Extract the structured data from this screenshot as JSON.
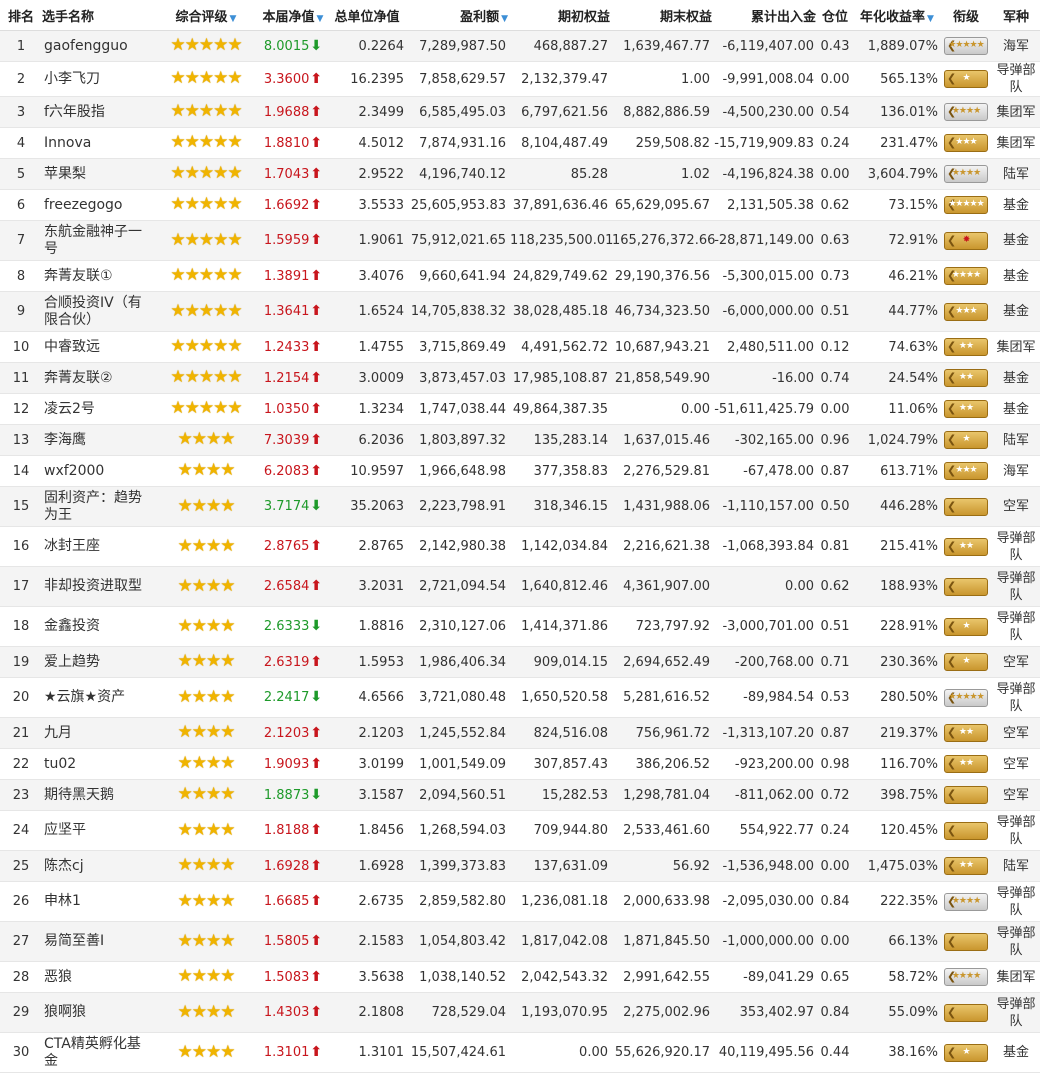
{
  "headers": {
    "rank": "排名",
    "name": "选手名称",
    "rating": "综合评级",
    "nav": "本届净值",
    "total_nav": "总单位净值",
    "profit": "盈利额",
    "begin_equity": "期初权益",
    "end_equity": "期末权益",
    "net_flow": "累计出入金",
    "position": "仓位",
    "annual": "年化收益率",
    "title": "衔级",
    "branch": "军种"
  },
  "rows": [
    {
      "rank": "1",
      "name": "gaofengguo",
      "stars": "★★★★★",
      "nav": "8.0015",
      "dir": "down",
      "total": "0.2264",
      "profit": "7,289,987.50",
      "begin": "468,887.27",
      "end": "1,639,467.77",
      "flow": "-6,119,407.00",
      "pos": "0.43",
      "annual": "1,889.07%",
      "badge": "★★★★★",
      "badge_style": "silver",
      "branch": "海军"
    },
    {
      "rank": "2",
      "name": "小李飞刀",
      "stars": "★★★★★",
      "nav": "3.3600",
      "dir": "up",
      "total": "16.2395",
      "profit": "7,858,629.57",
      "begin": "2,132,379.47",
      "end": "1.00",
      "flow": "-9,991,008.04",
      "pos": "0.00",
      "annual": "565.13%",
      "badge": "★",
      "badge_style": "gold",
      "branch": "导弹部队"
    },
    {
      "rank": "3",
      "name": "f六年股指",
      "stars": "★★★★★",
      "nav": "1.9688",
      "dir": "up",
      "total": "2.3499",
      "profit": "6,585,495.03",
      "begin": "6,797,621.56",
      "end": "8,882,886.59",
      "flow": "-4,500,230.00",
      "pos": "0.54",
      "annual": "136.01%",
      "badge": "★★★★",
      "badge_style": "silver",
      "branch": "集团军"
    },
    {
      "rank": "4",
      "name": "Innova",
      "stars": "★★★★★",
      "nav": "1.8810",
      "dir": "up",
      "total": "4.5012",
      "profit": "7,874,931.16",
      "begin": "8,104,487.49",
      "end": "259,508.82",
      "flow": "-15,719,909.83",
      "pos": "0.24",
      "annual": "231.47%",
      "badge": "★★★",
      "badge_style": "gold",
      "branch": "集团军"
    },
    {
      "rank": "5",
      "name": "苹果梨",
      "stars": "★★★★★",
      "nav": "1.7043",
      "dir": "up",
      "total": "2.9522",
      "profit": "4,196,740.12",
      "begin": "85.28",
      "end": "1.02",
      "flow": "-4,196,824.38",
      "pos": "0.00",
      "annual": "3,604.79%",
      "badge": "★★★★",
      "badge_style": "silver",
      "branch": "陆军"
    },
    {
      "rank": "6",
      "name": "freezegogo",
      "stars": "★★★★★",
      "nav": "1.6692",
      "dir": "up",
      "total": "3.5533",
      "profit": "25,605,953.83",
      "begin": "37,891,636.46",
      "end": "65,629,095.67",
      "flow": "2,131,505.38",
      "pos": "0.62",
      "annual": "73.15%",
      "badge": "★★★★★",
      "badge_style": "gold",
      "branch": "基金"
    },
    {
      "rank": "7",
      "name": "东航金融神子一号",
      "stars": "★★★★★",
      "nav": "1.5959",
      "dir": "up",
      "total": "1.9061",
      "profit": "75,912,021.65",
      "begin": "118,235,500.01",
      "end": "165,276,372.66",
      "flow": "-28,871,149.00",
      "pos": "0.63",
      "annual": "72.91%",
      "badge": "✸",
      "badge_style": "red",
      "branch": "基金",
      "tall": true
    },
    {
      "rank": "8",
      "name": "奔菁友联①",
      "stars": "★★★★★",
      "nav": "1.3891",
      "dir": "up",
      "total": "3.4076",
      "profit": "9,660,641.94",
      "begin": "24,829,749.62",
      "end": "29,190,376.56",
      "flow": "-5,300,015.00",
      "pos": "0.73",
      "annual": "46.21%",
      "badge": "★★★★",
      "badge_style": "gold",
      "branch": "基金"
    },
    {
      "rank": "9",
      "name": "合顺投资IV（有限合伙）",
      "stars": "★★★★★",
      "nav": "1.3641",
      "dir": "up",
      "total": "1.6524",
      "profit": "14,705,838.32",
      "begin": "38,028,485.18",
      "end": "46,734,323.50",
      "flow": "-6,000,000.00",
      "pos": "0.51",
      "annual": "44.77%",
      "badge": "★★★",
      "badge_style": "gold",
      "branch": "基金",
      "tall": true
    },
    {
      "rank": "10",
      "name": "中睿致远",
      "stars": "★★★★★",
      "nav": "1.2433",
      "dir": "up",
      "total": "1.4755",
      "profit": "3,715,869.49",
      "begin": "4,491,562.72",
      "end": "10,687,943.21",
      "flow": "2,480,511.00",
      "pos": "0.12",
      "annual": "74.63%",
      "badge": "★★",
      "badge_style": "gold",
      "branch": "集团军"
    },
    {
      "rank": "11",
      "name": "奔菁友联②",
      "stars": "★★★★★",
      "nav": "1.2154",
      "dir": "up",
      "total": "3.0009",
      "profit": "3,873,457.03",
      "begin": "17,985,108.87",
      "end": "21,858,549.90",
      "flow": "-16.00",
      "pos": "0.74",
      "annual": "24.54%",
      "badge": "★★",
      "badge_style": "gold",
      "branch": "基金"
    },
    {
      "rank": "12",
      "name": "凌云2号",
      "stars": "★★★★★",
      "nav": "1.0350",
      "dir": "up",
      "total": "1.3234",
      "profit": "1,747,038.44",
      "begin": "49,864,387.35",
      "end": "0.00",
      "flow": "-51,611,425.79",
      "pos": "0.00",
      "annual": "11.06%",
      "badge": "★★",
      "badge_style": "gold",
      "branch": "基金"
    },
    {
      "rank": "13",
      "name": "李海鹰",
      "stars": "★★★★",
      "nav": "7.3039",
      "dir": "up",
      "total": "6.2036",
      "profit": "1,803,897.32",
      "begin": "135,283.14",
      "end": "1,637,015.46",
      "flow": "-302,165.00",
      "pos": "0.96",
      "annual": "1,024.79%",
      "badge": "★",
      "badge_style": "gold",
      "branch": "陆军"
    },
    {
      "rank": "14",
      "name": "wxf2000",
      "stars": "★★★★",
      "nav": "6.2083",
      "dir": "up",
      "total": "10.9597",
      "profit": "1,966,648.98",
      "begin": "377,358.83",
      "end": "2,276,529.81",
      "flow": "-67,478.00",
      "pos": "0.87",
      "annual": "613.71%",
      "badge": "★★★",
      "badge_style": "gold",
      "branch": "海军"
    },
    {
      "rank": "15",
      "name": "固利资产：趋势为王",
      "stars": "★★★★",
      "nav": "3.7174",
      "dir": "down",
      "total": "35.2063",
      "profit": "2,223,798.91",
      "begin": "318,346.15",
      "end": "1,431,988.06",
      "flow": "-1,110,157.00",
      "pos": "0.50",
      "annual": "446.28%",
      "badge": "",
      "badge_style": "gold",
      "branch": "空军",
      "tall": true
    },
    {
      "rank": "16",
      "name": "冰封王座",
      "stars": "★★★★",
      "nav": "2.8765",
      "dir": "up",
      "total": "2.8765",
      "profit": "2,142,980.38",
      "begin": "1,142,034.84",
      "end": "2,216,621.38",
      "flow": "-1,068,393.84",
      "pos": "0.81",
      "annual": "215.41%",
      "badge": "★★",
      "badge_style": "gold",
      "branch": "导弹部队",
      "tall": true
    },
    {
      "rank": "17",
      "name": "非却投资进取型",
      "stars": "★★★★",
      "nav": "2.6584",
      "dir": "up",
      "total": "3.2031",
      "profit": "2,721,094.54",
      "begin": "1,640,812.46",
      "end": "4,361,907.00",
      "flow": "0.00",
      "pos": "0.62",
      "annual": "188.93%",
      "badge": "",
      "badge_style": "gold",
      "branch": "导弹部队",
      "tall": true
    },
    {
      "rank": "18",
      "name": "金鑫投资",
      "stars": "★★★★",
      "nav": "2.6333",
      "dir": "down",
      "total": "1.8816",
      "profit": "2,310,127.06",
      "begin": "1,414,371.86",
      "end": "723,797.92",
      "flow": "-3,000,701.00",
      "pos": "0.51",
      "annual": "228.91%",
      "badge": "★",
      "badge_style": "gold",
      "branch": "导弹部队",
      "tall": true
    },
    {
      "rank": "19",
      "name": "爱上趋势",
      "stars": "★★★★",
      "nav": "2.6319",
      "dir": "up",
      "total": "1.5953",
      "profit": "1,986,406.34",
      "begin": "909,014.15",
      "end": "2,694,652.49",
      "flow": "-200,768.00",
      "pos": "0.71",
      "annual": "230.36%",
      "badge": "★",
      "badge_style": "gold",
      "branch": "空军"
    },
    {
      "rank": "20",
      "name": "★云旗★资产",
      "stars": "★★★★",
      "nav": "2.2417",
      "dir": "down",
      "total": "4.6566",
      "profit": "3,721,080.48",
      "begin": "1,650,520.58",
      "end": "5,281,616.52",
      "flow": "-89,984.54",
      "pos": "0.53",
      "annual": "280.50%",
      "badge": "★★★★★",
      "badge_style": "silver",
      "branch": "导弹部队",
      "tall": true
    },
    {
      "rank": "21",
      "name": "九月",
      "stars": "★★★★",
      "nav": "2.1203",
      "dir": "up",
      "total": "2.1203",
      "profit": "1,245,552.84",
      "begin": "824,516.08",
      "end": "756,961.72",
      "flow": "-1,313,107.20",
      "pos": "0.87",
      "annual": "219.37%",
      "badge": "★★",
      "badge_style": "gold",
      "branch": "空军"
    },
    {
      "rank": "22",
      "name": "tu02",
      "stars": "★★★★",
      "nav": "1.9093",
      "dir": "up",
      "total": "3.0199",
      "profit": "1,001,549.09",
      "begin": "307,857.43",
      "end": "386,206.52",
      "flow": "-923,200.00",
      "pos": "0.98",
      "annual": "116.70%",
      "badge": "★★",
      "badge_style": "gold",
      "branch": "空军"
    },
    {
      "rank": "23",
      "name": "期待黑天鹅",
      "stars": "★★★★",
      "nav": "1.8873",
      "dir": "down",
      "total": "3.1587",
      "profit": "2,094,560.51",
      "begin": "15,282.53",
      "end": "1,298,781.04",
      "flow": "-811,062.00",
      "pos": "0.72",
      "annual": "398.75%",
      "badge": "",
      "badge_style": "gold",
      "branch": "空军"
    },
    {
      "rank": "24",
      "name": "应坚平",
      "stars": "★★★★",
      "nav": "1.8188",
      "dir": "up",
      "total": "1.8456",
      "profit": "1,268,594.03",
      "begin": "709,944.80",
      "end": "2,533,461.60",
      "flow": "554,922.77",
      "pos": "0.24",
      "annual": "120.45%",
      "badge": "",
      "badge_style": "gold",
      "branch": "导弹部队",
      "tall": true
    },
    {
      "rank": "25",
      "name": "陈杰cj",
      "stars": "★★★★",
      "nav": "1.6928",
      "dir": "up",
      "total": "1.6928",
      "profit": "1,399,373.83",
      "begin": "137,631.09",
      "end": "56.92",
      "flow": "-1,536,948.00",
      "pos": "0.00",
      "annual": "1,475.03%",
      "badge": "★★",
      "badge_style": "gold",
      "branch": "陆军"
    },
    {
      "rank": "26",
      "name": "申林1",
      "stars": "★★★★",
      "nav": "1.6685",
      "dir": "up",
      "total": "2.6735",
      "profit": "2,859,582.80",
      "begin": "1,236,081.18",
      "end": "2,000,633.98",
      "flow": "-2,095,030.00",
      "pos": "0.84",
      "annual": "222.35%",
      "badge": "★★★★",
      "badge_style": "silver",
      "branch": "导弹部队",
      "tall": true
    },
    {
      "rank": "27",
      "name": "易简至善I",
      "stars": "★★★★",
      "nav": "1.5805",
      "dir": "up",
      "total": "2.1583",
      "profit": "1,054,803.42",
      "begin": "1,817,042.08",
      "end": "1,871,845.50",
      "flow": "-1,000,000.00",
      "pos": "0.00",
      "annual": "66.13%",
      "badge": "",
      "badge_style": "gold",
      "branch": "导弹部队",
      "tall": true
    },
    {
      "rank": "28",
      "name": "恶狼",
      "stars": "★★★★",
      "nav": "1.5083",
      "dir": "up",
      "total": "3.5638",
      "profit": "1,038,140.52",
      "begin": "2,042,543.32",
      "end": "2,991,642.55",
      "flow": "-89,041.29",
      "pos": "0.65",
      "annual": "58.72%",
      "badge": "★★★★",
      "badge_style": "silver",
      "branch": "集团军"
    },
    {
      "rank": "29",
      "name": "狼啊狼",
      "stars": "★★★★",
      "nav": "1.4303",
      "dir": "up",
      "total": "2.1808",
      "profit": "728,529.04",
      "begin": "1,193,070.95",
      "end": "2,275,002.96",
      "flow": "353,402.97",
      "pos": "0.84",
      "annual": "55.09%",
      "badge": "",
      "badge_style": "gold",
      "branch": "导弹部队",
      "tall": true
    },
    {
      "rank": "30",
      "name": "CTA精英孵化基金",
      "stars": "★★★★",
      "nav": "1.3101",
      "dir": "up",
      "total": "1.3101",
      "profit": "15,507,424.61",
      "begin": "0.00",
      "end": "55,626,920.17",
      "flow": "40,119,495.56",
      "pos": "0.44",
      "annual": "38.16%",
      "badge": "★",
      "badge_style": "gold",
      "branch": "基金",
      "tall": true
    }
  ],
  "icons": {
    "sort": "triangle-down-icon",
    "up": "arrow-up-icon",
    "down": "arrow-down-icon",
    "star": "star-icon"
  },
  "colors": {
    "up": "#c8161d",
    "down": "#1e9a2a",
    "star": "#f0b400",
    "sort": "#3d8fd6"
  }
}
